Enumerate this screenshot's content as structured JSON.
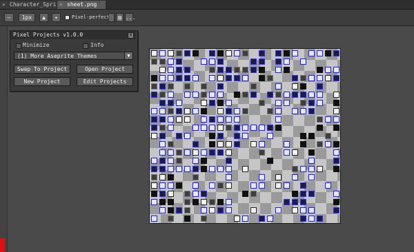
{
  "tabs": [
    {
      "label": "Character_Spri",
      "close": "✕"
    },
    {
      "label": "sheet.png",
      "close": "✕"
    }
  ],
  "toolbar": {
    "brush_size": "1px",
    "pixel_perfect_label": "Pixel-perfect",
    "pixel_perfect_checked": true,
    "more_label": "..."
  },
  "panel": {
    "title": "Pixel Projects v1.0.0",
    "close": "x",
    "minimize_label": "Minimize",
    "info_label": "Info",
    "selected_project": "(1) More Aseprite Themes",
    "buttons": {
      "swap": "Swap To Project",
      "open": "Open Project",
      "new": "New Project",
      "edit": "Edit Projects"
    }
  },
  "colors": {
    "accent_blue": "#1a1aff",
    "dark_bg": "#3a3a3a",
    "red_chip": "#e01010"
  }
}
